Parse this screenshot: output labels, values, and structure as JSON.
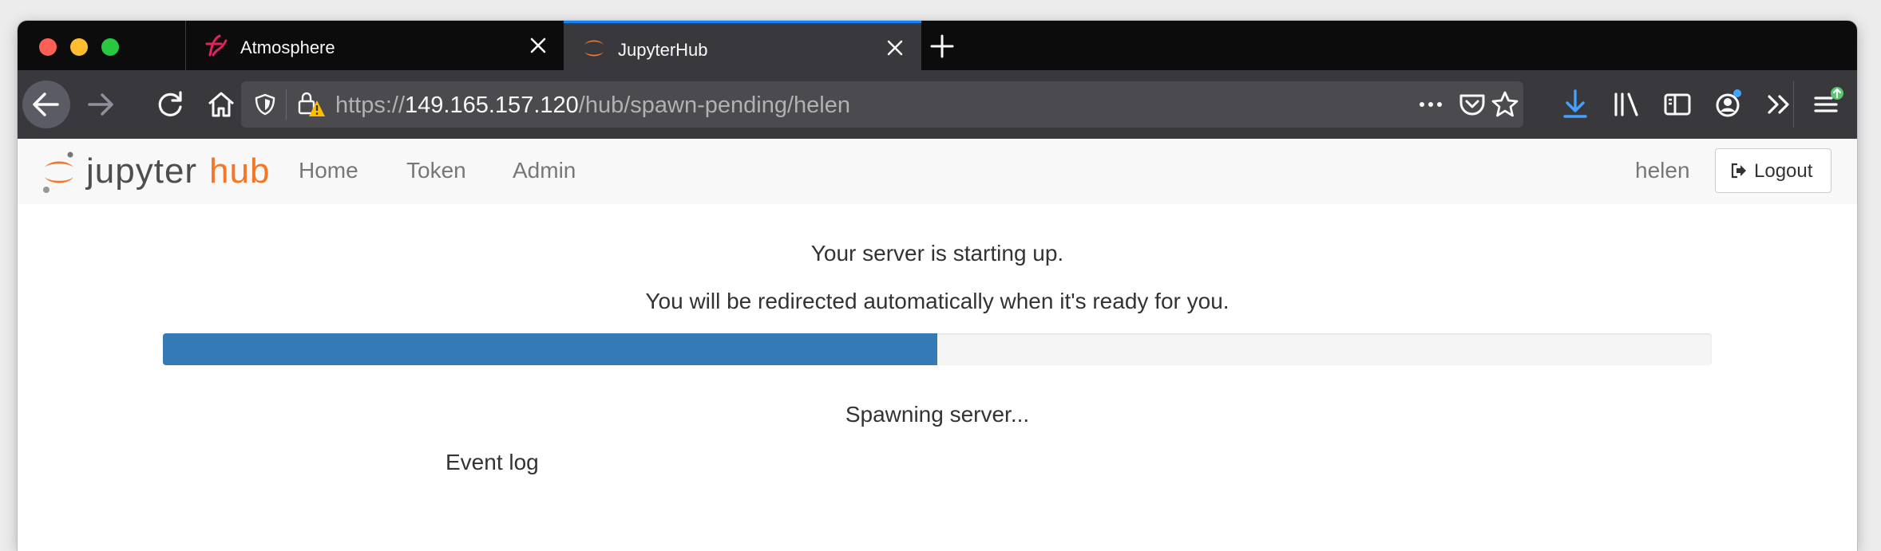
{
  "browser": {
    "tabs": [
      {
        "label": "Atmosphere",
        "active": false,
        "icon": "atmosphere-favicon"
      },
      {
        "label": "JupyterHub",
        "active": true,
        "icon": "jupyter-favicon"
      }
    ],
    "url": {
      "scheme": "https://",
      "host": "149.165.157.120",
      "path": "/hub/spawn-pending/helen"
    },
    "accent_color": "#0a84ff"
  },
  "navbar": {
    "logo_text_left": "jupyter",
    "logo_text_right": "hub",
    "links": [
      "Home",
      "Token",
      "Admin"
    ],
    "username": "helen",
    "logout_label": "Logout"
  },
  "main": {
    "status_line1": "Your server is starting up.",
    "status_line2": "You will be redirected automatically when it's ready for you.",
    "progress_percent": 50,
    "progress_message": "Spawning server...",
    "event_log_label": "Event log",
    "progress_color": "#337ab7"
  }
}
